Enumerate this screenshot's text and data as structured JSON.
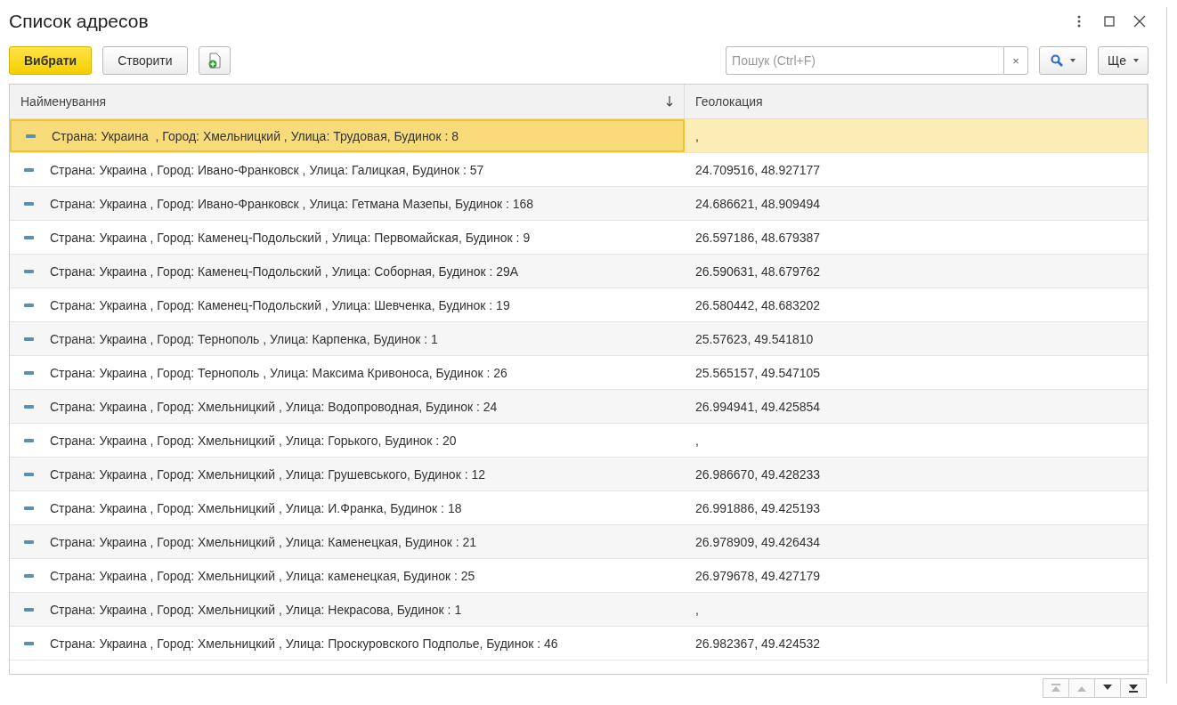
{
  "window": {
    "title": "Список адресов"
  },
  "toolbar": {
    "buttons": [
      {
        "label": "Вибрати",
        "kind": "primary"
      },
      {
        "label": "Створити",
        "kind": "plain"
      },
      {
        "kind": "icon"
      }
    ],
    "search": {
      "placeholder": "Пошук (Ctrl+F)",
      "clear": "×"
    },
    "more": "Ще"
  },
  "table": {
    "columns": [
      {
        "label": "Найменування",
        "sorted": true
      },
      {
        "label": "Геолокация",
        "sorted": false
      }
    ],
    "rows": [
      {
        "name": "Страна: Украина  , Город: Хмельницкий , Улица: Трудовая, Будинок : 8",
        "geo": ",",
        "selected": true
      },
      {
        "name": "Страна: Украина , Город: Ивано-Франковск , Улица: Галицкая, Будинок : 57",
        "geo": "24.709516, 48.927177",
        "selected": false
      },
      {
        "name": "Страна: Украина , Город: Ивано-Франковск , Улица: Гетмана Мазепы, Будинок : 168",
        "geo": "24.686621, 48.909494",
        "selected": false
      },
      {
        "name": "Страна: Украина , Город: Каменец-Подольский , Улица: Первомайская, Будинок : 9",
        "geo": "26.597186, 48.679387",
        "selected": false
      },
      {
        "name": "Страна: Украина , Город: Каменец-Подольский , Улица: Соборная, Будинок : 29А",
        "geo": "26.590631, 48.679762",
        "selected": false
      },
      {
        "name": "Страна: Украина , Город: Каменец-Подольский , Улица: Шевченка, Будинок : 19",
        "geo": "26.580442, 48.683202",
        "selected": false
      },
      {
        "name": "Страна: Украина , Город: Тернополь , Улица: Карпенка, Будинок : 1",
        "geo": "25.57623, 49.541810",
        "selected": false
      },
      {
        "name": "Страна: Украина , Город: Тернополь , Улица: Максима Кривоноса, Будинок : 26",
        "geo": "25.565157, 49.547105",
        "selected": false
      },
      {
        "name": "Страна: Украина , Город: Хмельницкий , Улица: Водопроводная, Будинок : 24",
        "geo": "26.994941, 49.425854",
        "selected": false
      },
      {
        "name": "Страна: Украина , Город: Хмельницкий , Улица: Горького, Будинок : 20",
        "geo": ",",
        "selected": false
      },
      {
        "name": "Страна: Украина , Город: Хмельницкий , Улица: Грушевського, Будинок : 12",
        "geo": "26.986670, 49.428233",
        "selected": false
      },
      {
        "name": "Страна: Украина , Город: Хмельницкий , Улица: И.Франка, Будинок : 18",
        "geo": "26.991886, 49.425193",
        "selected": false
      },
      {
        "name": "Страна: Украина , Город: Хмельницкий , Улица: Каменецкая, Будинок : 21",
        "geo": "26.978909, 49.426434",
        "selected": false
      },
      {
        "name": "Страна: Украина , Город: Хмельницкий , Улица: каменецкая, Будинок : 25",
        "geo": "26.979678, 49.427179",
        "selected": false
      },
      {
        "name": "Страна: Украина , Город: Хмельницкий , Улица: Некрасова, Будинок : 1",
        "geo": ",",
        "selected": false
      },
      {
        "name": "Страна: Украина , Город: Хмельницкий , Улица: Проскуровского Подполье, Будинок : 46",
        "geo": "26.982367, 49.424532",
        "selected": false
      }
    ]
  }
}
